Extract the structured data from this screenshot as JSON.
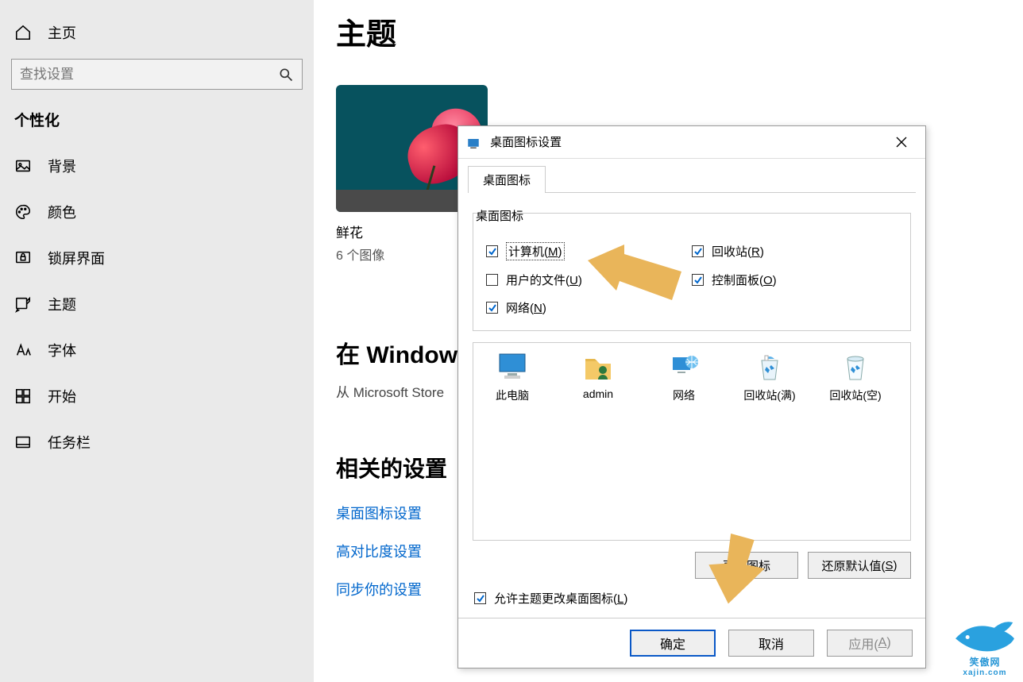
{
  "sidebar": {
    "home_label": "主页",
    "search_placeholder": "查找设置",
    "section_title": "个性化",
    "items": [
      {
        "label": "背景"
      },
      {
        "label": "颜色"
      },
      {
        "label": "锁屏界面"
      },
      {
        "label": "主题"
      },
      {
        "label": "字体"
      },
      {
        "label": "开始"
      },
      {
        "label": "任务栏"
      }
    ]
  },
  "main": {
    "title": "主题",
    "theme": {
      "name": "鲜花",
      "count": "6 个图像"
    },
    "store_heading_partial": "在 Windows 中",
    "store_subtext_partial": "从 Microsoft Store ",
    "related_heading": "相关的设置",
    "links": [
      "桌面图标设置",
      "高对比度设置",
      "同步你的设置"
    ]
  },
  "dialog": {
    "title": "桌面图标设置",
    "tab_label": "桌面图标",
    "group_label": "桌面图标",
    "checks": {
      "computer": {
        "label": "计算机(",
        "accel": "M",
        "suffix": ")",
        "checked": true,
        "focused": true
      },
      "user_files": {
        "label": "用户的文件(",
        "accel": "U",
        "suffix": ")",
        "checked": false
      },
      "network": {
        "label": "网络(",
        "accel": "N",
        "suffix": ")",
        "checked": true
      },
      "recycle": {
        "label": "回收站(",
        "accel": "R",
        "suffix": ")",
        "checked": true
      },
      "control_panel": {
        "label": "控制面板(",
        "accel": "O",
        "suffix": ")",
        "checked": true
      }
    },
    "icons": [
      {
        "label": "此电脑"
      },
      {
        "label": "admin"
      },
      {
        "label": "网络"
      },
      {
        "label": "回收站(满)"
      },
      {
        "label": "回收站(空)"
      }
    ],
    "buttons": {
      "change_icon_partial": "更改图标",
      "restore_defaults": "还原默认值(",
      "restore_defaults_accel": "S",
      "restore_defaults_suffix": ")"
    },
    "allow_theme": {
      "label": "允许主题更改桌面图标(",
      "accel": "L",
      "suffix": ")",
      "checked": true
    },
    "footer": {
      "ok": "确定",
      "cancel": "取消",
      "apply": "应用(",
      "apply_accel": "A",
      "apply_suffix": ")"
    }
  },
  "watermark": {
    "brand": "笑傲网",
    "url": "xajin.com"
  },
  "colors": {
    "link": "#0066cc",
    "arrow": "#e9b55a"
  }
}
